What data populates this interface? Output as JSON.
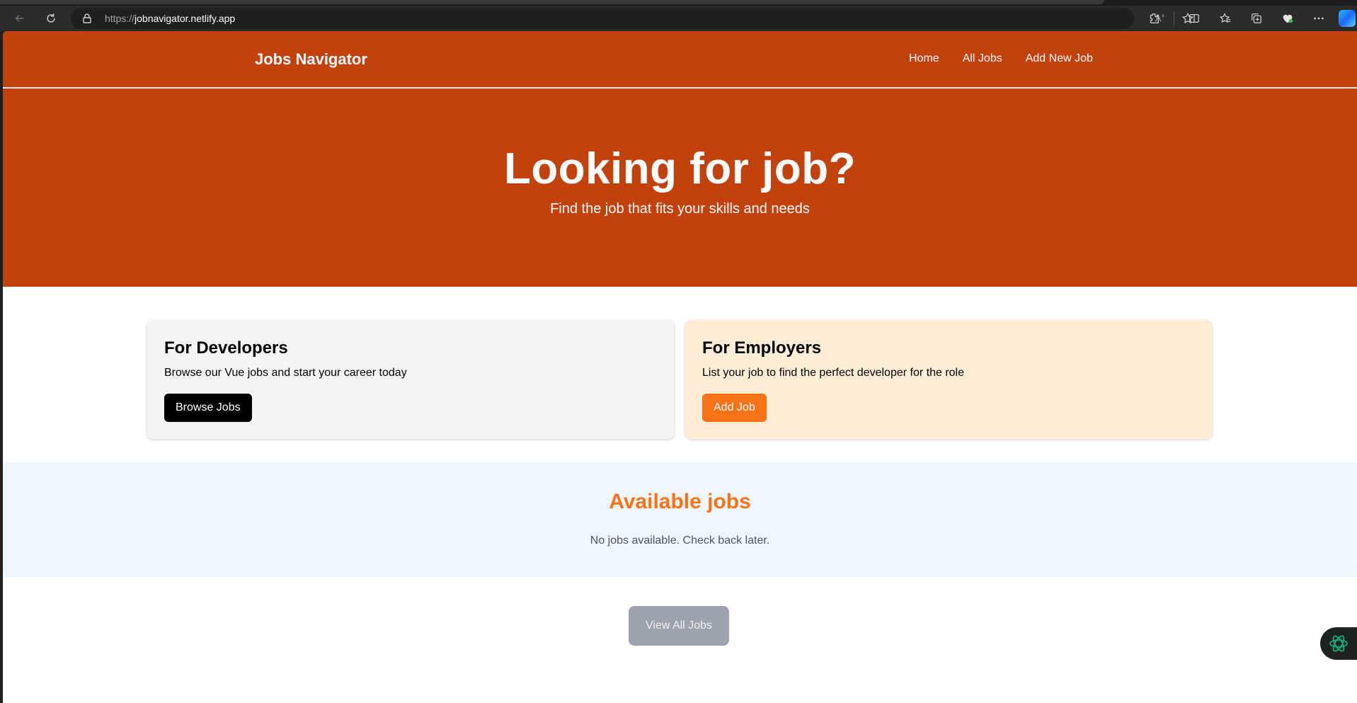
{
  "browser": {
    "url_prefix": "https://",
    "url_host": "jobnavigator.netlify.app",
    "icons": [
      "back-icon",
      "reload-icon",
      "lock-icon",
      "read-aloud-icon",
      "favorite-star-icon",
      "extensions-icon",
      "split-screen-icon",
      "favorites-icon",
      "collections-icon",
      "browser-health-icon",
      "more-icon",
      "copilot-icon"
    ],
    "read_aloud_glyph": "A̅"
  },
  "nav": {
    "brand": "Jobs Navigator",
    "links": [
      "Home",
      "All Jobs",
      "Add New Job"
    ]
  },
  "hero": {
    "title": "Looking for job?",
    "subtitle": "Find the job that fits your skills and needs"
  },
  "cards": {
    "developers": {
      "title": "For Developers",
      "text": "Browse our Vue jobs and start your career today",
      "button": "Browse Jobs"
    },
    "employers": {
      "title": "For Employers",
      "text": "List your job to find the perfect developer for the role",
      "button": "Add Job"
    }
  },
  "jobs": {
    "heading": "Available jobs",
    "empty_message": "No jobs available. Check back later."
  },
  "view_all": "View All Jobs",
  "colors": {
    "primary": "#c2410c",
    "accent": "#f97316",
    "dev_card": "#f3f4f6",
    "emp_card": "#ffedd5",
    "jobs_bg": "#eff6ff",
    "view_all_bg": "#9ca3af"
  }
}
